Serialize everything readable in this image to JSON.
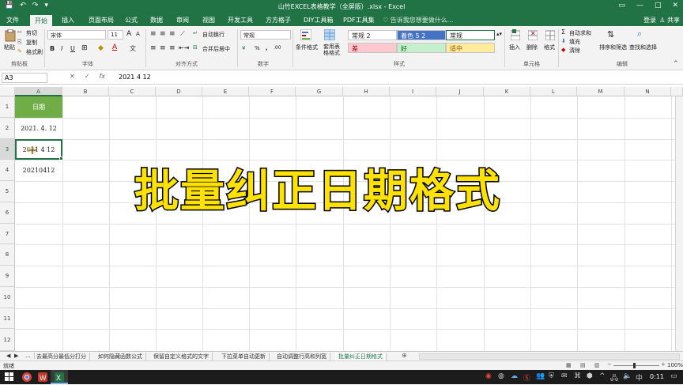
{
  "window": {
    "title": "山竹EXCEL表格教学（全屏版）.xlsx - Excel",
    "quick_access": [
      "💾",
      "↶",
      "↷",
      "▾"
    ]
  },
  "tabs": [
    {
      "label": "文件"
    },
    {
      "label": "开始"
    },
    {
      "label": "插入"
    },
    {
      "label": "页面布局"
    },
    {
      "label": "公式"
    },
    {
      "label": "数据"
    },
    {
      "label": "审阅"
    },
    {
      "label": "视图"
    },
    {
      "label": "开发工具"
    },
    {
      "label": "方方格子"
    },
    {
      "label": "DIY工具箱"
    },
    {
      "label": "PDF工具集"
    }
  ],
  "tell_me": "♡ 告诉我您想要做什么...",
  "login": "登录",
  "share": "♙ 共享",
  "ribbon": {
    "clipboard": {
      "paste": "粘贴",
      "cut": "剪切",
      "copy": "复制",
      "format_painter": "格式刷",
      "label": "剪贴板"
    },
    "font": {
      "name": "宋体",
      "size": "11",
      "label": "字体",
      "bold": "B",
      "italic": "I",
      "underline": "U"
    },
    "alignment": {
      "wrap": "自动换行",
      "merge": "合并后居中",
      "label": "对齐方式"
    },
    "number": {
      "format": "常规",
      "label": "数字",
      "percent": "%",
      "comma": ","
    },
    "styles": {
      "conditional": "条件格式",
      "table": "套用表格格式",
      "label": "样式",
      "cells": [
        {
          "text": "常规 2",
          "bg": "#ffffff",
          "color": "#222222"
        },
        {
          "text": "着色 5 2",
          "bg": "#4472c4",
          "color": "#ffffff"
        },
        {
          "text": "常规",
          "bg": "#ffffff",
          "color": "#222222"
        },
        {
          "text": "差",
          "bg": "#ffc7ce",
          "color": "#9c0006"
        },
        {
          "text": "好",
          "bg": "#c6efce",
          "color": "#006100"
        },
        {
          "text": "适中",
          "bg": "#ffeb9c",
          "color": "#9c5700"
        }
      ]
    },
    "cells_group": {
      "insert": "插入",
      "delete": "删除",
      "format": "格式",
      "label": "单元格"
    },
    "editing": {
      "autosum": "自动求和",
      "fill": "填充",
      "clear": "清除",
      "sort": "排序和筛选",
      "find": "查找和选择",
      "label": "编辑"
    }
  },
  "formula_bar": {
    "name_box": "A3",
    "cancel": "✕",
    "enter": "✓",
    "fx": "fx",
    "value": "2021 4 12"
  },
  "columns": [
    "A",
    "B",
    "C",
    "D",
    "E",
    "F",
    "G",
    "H",
    "I",
    "J",
    "K",
    "L",
    "M",
    "N"
  ],
  "rows": [
    "1",
    "2",
    "3",
    "4",
    "5",
    "6",
    "7",
    "8",
    "9",
    "10",
    "11",
    "12"
  ],
  "cells": {
    "A1": "日期",
    "A2": "2021. 4. 12",
    "A3": "2021 4  12",
    "A4": "20210412"
  },
  "overlay_title": "批量纠正日期格式",
  "sheet_tabs": [
    "...",
    "去最高分最低分打分",
    "如何隐藏函数公式",
    "保留自定义格式的文字",
    "下拉菜单自动更新",
    "自动调整行高和列宽",
    "批量纠正日期格式"
  ],
  "add_sheet": "⊕",
  "status": {
    "ready": "就绪",
    "zoom": "100%"
  },
  "taskbar": {
    "time": "0:11"
  },
  "colors": {
    "excel_green": "#217346",
    "header_green": "#70ad47",
    "overlay_yellow": "#ffe200"
  }
}
